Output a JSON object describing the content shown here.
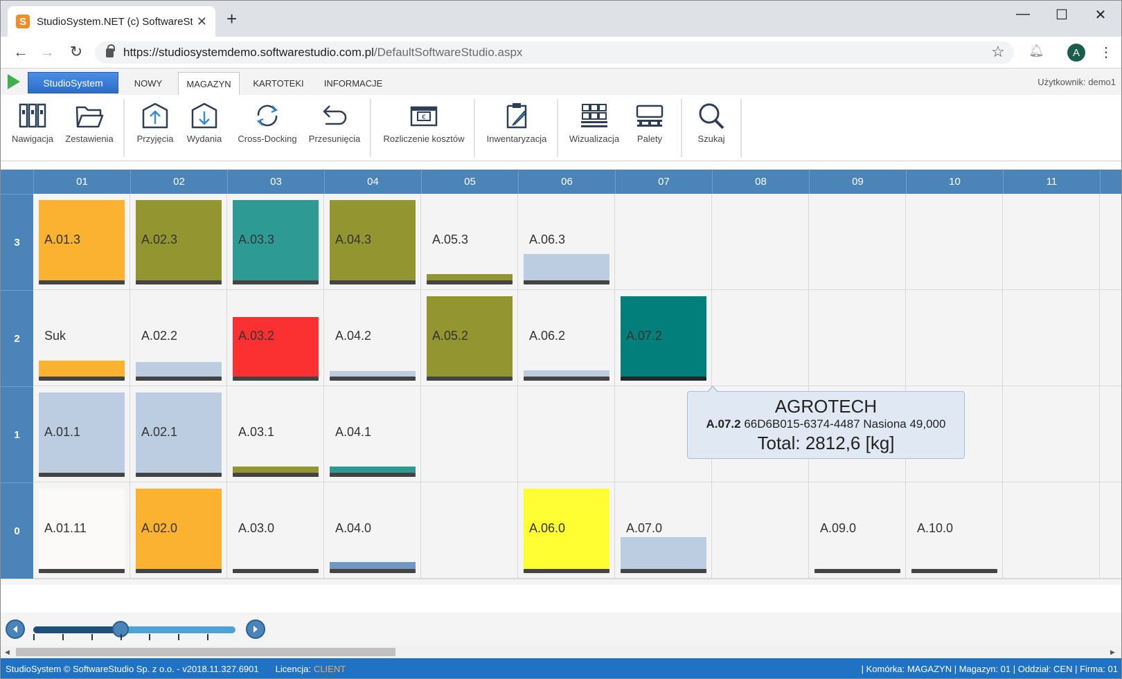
{
  "browser": {
    "tab_title": "StudioSystem.NET (c) SoftwareStudio",
    "favicon": "S",
    "close": "✕",
    "new_tab": "+",
    "win_min": "—",
    "win_max": "☐",
    "win_close": "✕",
    "url_host": "https://studiosystemdemo.softwarestudio.com.pl",
    "url_path": "/DefaultSoftwareStudio.aspx",
    "avatar": "A"
  },
  "menu": {
    "app_button": "StudioSystem",
    "tabs": [
      "NOWY",
      "MAGAZYN",
      "KARTOTEKI",
      "INFORMACJE"
    ],
    "active_tab": "MAGAZYN",
    "user": "Użytkownik: demo1"
  },
  "toolbar": {
    "items": [
      "Nawigacja",
      "Zestawienia",
      "Przyjęcia",
      "Wydania",
      "Cross-Docking",
      "Przesunięcia",
      "Rozliczenie kosztów",
      "Inwentaryzacja",
      "Wizualizacja",
      "Palety",
      "Szukaj"
    ],
    "icons": [
      "binders-icon",
      "folder-icon",
      "inbound-icon",
      "outbound-icon",
      "cross-docking-icon",
      "move-icon",
      "cost-settlement-icon",
      "inventory-icon",
      "visualization-icon",
      "pallets-icon",
      "search-icon"
    ]
  },
  "grid": {
    "columns": [
      "01",
      "02",
      "03",
      "04",
      "05",
      "06",
      "07",
      "08",
      "09",
      "10",
      "11"
    ],
    "rows": [
      "3",
      "2",
      "1",
      "0"
    ],
    "cells": {
      "3": [
        {
          "label": "A.01.3",
          "fill": 1.0,
          "color": "#fbb231"
        },
        {
          "label": "A.02.3",
          "fill": 1.0,
          "color": "#939630"
        },
        {
          "label": "A.03.3",
          "fill": 1.0,
          "color": "#2e9a94"
        },
        {
          "label": "A.04.3",
          "fill": 1.0,
          "color": "#939630"
        },
        {
          "label": "A.05.3",
          "fill": 0.08,
          "color": "#939630"
        },
        {
          "label": "A.06.3",
          "fill": 0.33,
          "color": "#bccde2"
        },
        null,
        null,
        null,
        null,
        null
      ],
      "2": [
        {
          "label": "Suk",
          "fill": 0.2,
          "color": "#fbb231"
        },
        {
          "label": "A.02.2",
          "fill": 0.18,
          "color": "#bccde2"
        },
        {
          "label": "A.03.2",
          "fill": 0.74,
          "color": "#fb3030"
        },
        {
          "label": "A.04.2",
          "fill": 0.07,
          "color": "#bccde2"
        },
        {
          "label": "A.05.2",
          "fill": 1.0,
          "color": "#939630"
        },
        {
          "label": "A.06.2",
          "fill": 0.08,
          "color": "#bccde2"
        },
        {
          "label": "A.07.2",
          "fill": 1.0,
          "color": "#037f7b"
        },
        null,
        null,
        null,
        null
      ],
      "1": [
        {
          "label": "A.01.1",
          "fill": 1.0,
          "color": "#bccde2"
        },
        {
          "label": "A.02.1",
          "fill": 1.0,
          "color": "#bccde2"
        },
        {
          "label": "A.03.1",
          "fill": 0.08,
          "color": "#939630"
        },
        {
          "label": "A.04.1",
          "fill": 0.08,
          "color": "#2e9a94"
        },
        null,
        null,
        null,
        null,
        null,
        null,
        null
      ],
      "0": [
        {
          "label": "A.01.11",
          "fill": 1.0,
          "color": "#fcfaf8"
        },
        {
          "label": "A.02.0",
          "fill": 1.0,
          "color": "#fbb231"
        },
        {
          "label": "A.03.0",
          "fill": 0.0,
          "color": "#bccde2"
        },
        {
          "label": "A.04.0",
          "fill": 0.09,
          "color": "#6f99c1"
        },
        null,
        {
          "label": "A.06.0",
          "fill": 1.0,
          "color": "#fefe32"
        },
        {
          "label": "A.07.0",
          "fill": 0.4,
          "color": "#bccde2"
        },
        null,
        {
          "label": "A.09.0",
          "fill": 0.0,
          "color": "#bccde2"
        },
        {
          "label": "A.10.0",
          "fill": 0.0,
          "color": "#bccde2"
        },
        null
      ]
    }
  },
  "tooltip": {
    "title": "AGROTECH",
    "location": "A.07.2",
    "detail": "66D6B015-6374-4487 Nasiona 49,000",
    "total": "Total: 2812,6 [kg]"
  },
  "slider": {
    "position_fraction": 0.43,
    "ticks": 7
  },
  "status": {
    "left": "StudioSystem © SoftwareStudio Sp. z o.o. - v2018.11.327.6901",
    "license_label": "Licencja:",
    "license_value": "CLIENT",
    "right": "| Komórka: MAGAZYN | Magazyn: 01 | Oddział: CEN | Firma: 01"
  }
}
